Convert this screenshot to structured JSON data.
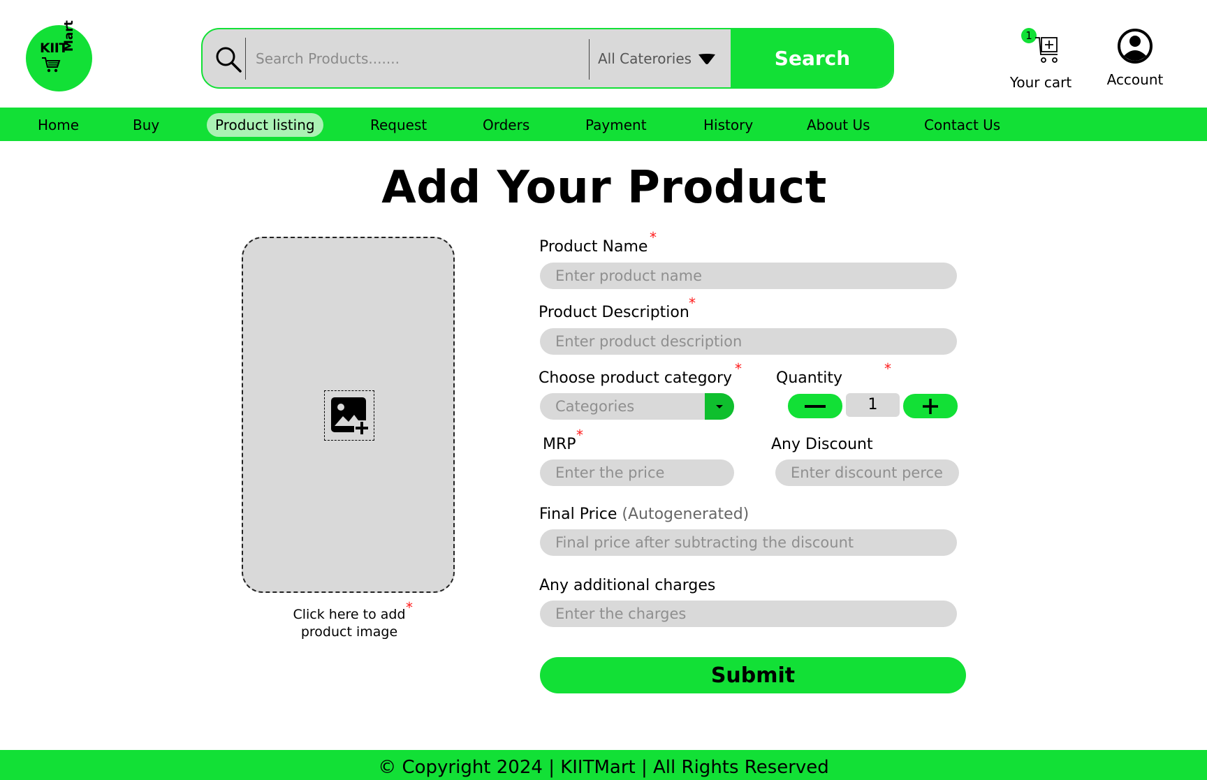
{
  "brand": {
    "logo_line1": "KIIT",
    "logo_line2": "Mart"
  },
  "search": {
    "placeholder": "Search Products.......",
    "category_label": "All Caterories",
    "button_label": "Search"
  },
  "header": {
    "cart_label": "Your cart",
    "cart_count": "1",
    "account_label": "Account"
  },
  "nav": {
    "items": [
      "Home",
      "Buy",
      "Product listing",
      "Request",
      "Orders",
      "Payment",
      "History",
      "About Us",
      "Contact Us"
    ],
    "active": "Product listing"
  },
  "page": {
    "title": "Add Your Product"
  },
  "upload": {
    "caption_line1": "Click here to add",
    "caption_line2": "product image"
  },
  "form": {
    "product_name": {
      "label": "Product Name",
      "placeholder": "Enter product name",
      "required": true
    },
    "product_description": {
      "label": "Product Description",
      "placeholder": "Enter product description",
      "required": true
    },
    "category": {
      "label": "Choose product category",
      "value": "Categories",
      "required": true
    },
    "quantity": {
      "label": "Quantity",
      "value": "1",
      "required": true
    },
    "mrp": {
      "label": "MRP",
      "placeholder": "Enter the price",
      "required": true
    },
    "discount": {
      "label": "Any Discount",
      "placeholder": "Enter discount percent"
    },
    "final_price": {
      "label": "Final Price",
      "note": "(Autogenerated)",
      "placeholder": "Final price after subtracting the discount"
    },
    "charges": {
      "label": "Any additional charges",
      "placeholder": "Enter the charges"
    },
    "submit_label": "Submit",
    "required_mark": "*"
  },
  "footer": {
    "text": "© Copyright 2024 | KIITMart | All Rights Reserved"
  },
  "colors": {
    "accent": "#12e036",
    "field": "#d9d9d9",
    "required": "#ff1b1b",
    "active_nav": "#aaf2b4"
  }
}
